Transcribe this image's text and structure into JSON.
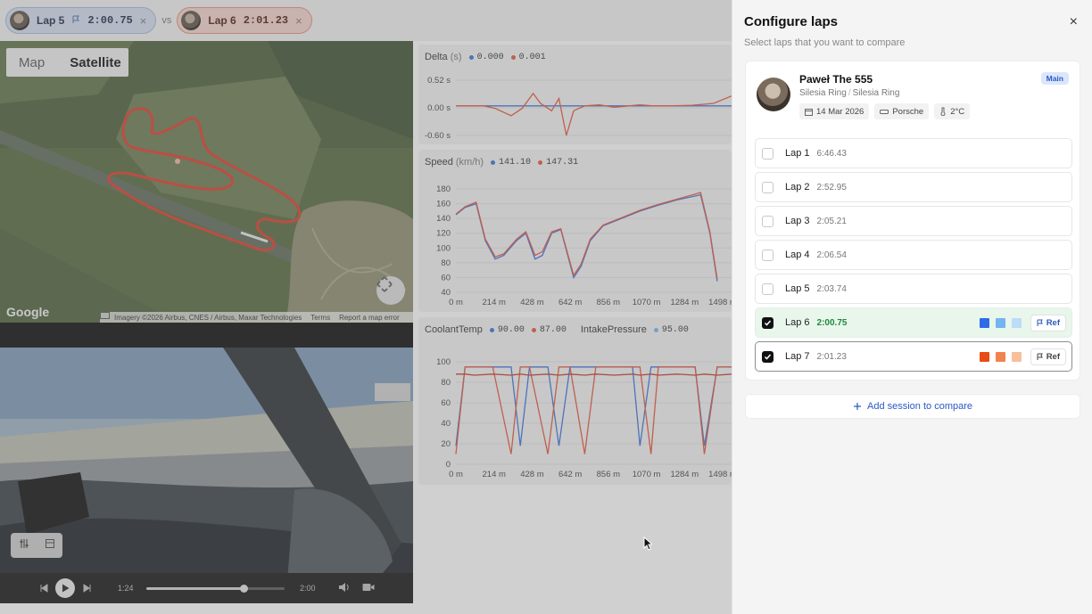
{
  "topbar": {
    "lap_a": {
      "label": "Lap 5",
      "time": "2:00.75",
      "close": "×"
    },
    "vs": "vs",
    "lap_b": {
      "label": "Lap 6",
      "time": "2:01.23",
      "close": "×"
    }
  },
  "map": {
    "toggle_map": "Map",
    "toggle_satellite": "Satellite",
    "logo": "Google",
    "attribution": "Imagery ©2026 Airbus, CNES / Airbus, Maxar Technologies",
    "terms": "Terms",
    "report": "Report a map error"
  },
  "video": {
    "current_time": "1:24",
    "duration": "2:00",
    "progress": 0.7
  },
  "charts": {
    "delta": {
      "title": "Delta",
      "unit": "(s)",
      "val_a": "0.000",
      "val_b": "0.001"
    },
    "speed": {
      "title": "Speed",
      "unit": "(km/h)",
      "val_a": "141.10",
      "val_b": "147.31"
    },
    "coolant": {
      "title": "CoolantTemp",
      "val_a": "90.00",
      "val_b": "87.00",
      "title2": "IntakePressure",
      "val_c": "95.00"
    }
  },
  "chart_data": [
    {
      "type": "line",
      "title": "Delta",
      "ylabel": "(s)",
      "yticks": [
        "0.52 s",
        "0.00 s",
        "-0.60 s"
      ],
      "ylim": [
        -0.6,
        0.52
      ],
      "x": [
        0,
        150,
        214,
        300,
        360,
        420,
        460,
        520,
        560,
        600,
        640,
        700,
        780,
        860,
        940,
        1000,
        1070,
        1150,
        1284,
        1400,
        1498
      ],
      "series": [
        {
          "color": "#3b6fd8",
          "values": [
            0,
            0,
            0,
            0,
            0,
            0,
            0,
            0,
            0,
            0,
            0,
            0,
            0,
            0,
            0,
            0,
            0,
            0,
            0,
            0,
            0
          ]
        },
        {
          "color": "#e0553b",
          "values": [
            0,
            0,
            -0.05,
            -0.2,
            -0.05,
            0.25,
            0.05,
            -0.1,
            0.15,
            -0.6,
            -0.1,
            0,
            0.02,
            -0.03,
            0,
            0.02,
            0,
            0,
            0.01,
            0.05,
            0.2
          ]
        }
      ]
    },
    {
      "type": "line",
      "title": "Speed",
      "ylabel": "(km/h)",
      "ylim": [
        40,
        180
      ],
      "yticks": [
        "180",
        "160",
        "140",
        "120",
        "100",
        "80",
        "60",
        "40"
      ],
      "xticks": [
        "0 m",
        "214 m",
        "428 m",
        "642 m",
        "856 m",
        "1070 m",
        "1284 m",
        "1498 m"
      ],
      "x": [
        0,
        50,
        110,
        160,
        214,
        260,
        330,
        380,
        430,
        470,
        520,
        570,
        640,
        680,
        730,
        800,
        900,
        1000,
        1100,
        1200,
        1330,
        1380,
        1420
      ],
      "series": [
        {
          "color": "#3b6fd8",
          "values": [
            145,
            155,
            160,
            110,
            85,
            90,
            110,
            120,
            85,
            90,
            120,
            125,
            60,
            75,
            110,
            130,
            140,
            150,
            158,
            165,
            172,
            120,
            55
          ]
        },
        {
          "color": "#e0553b",
          "values": [
            146,
            156,
            162,
            112,
            88,
            92,
            112,
            122,
            90,
            95,
            122,
            126,
            63,
            78,
            112,
            131,
            141,
            151,
            159,
            166,
            175,
            122,
            58
          ]
        }
      ]
    },
    {
      "type": "line",
      "title": "CoolantTemp",
      "ylim": [
        0,
        100
      ],
      "yticks": [
        "100",
        "80",
        "60",
        "40",
        "20",
        "0"
      ],
      "xticks": [
        "0 m",
        "214 m",
        "428 m",
        "642 m",
        "856 m",
        "1070 m",
        "1284 m",
        "1498 m"
      ],
      "x": [
        0,
        50,
        100,
        200,
        300,
        350,
        400,
        500,
        560,
        620,
        700,
        760,
        860,
        960,
        1000,
        1060,
        1100,
        1200,
        1300,
        1350,
        1420,
        1498
      ],
      "series": [
        {
          "color": "#3b6fd8",
          "values": [
            18,
            95,
            95,
            95,
            95,
            18,
            95,
            95,
            18,
            95,
            95,
            95,
            95,
            95,
            18,
            95,
            95,
            95,
            95,
            18,
            95,
            95
          ]
        },
        {
          "color": "#e0553b",
          "values": [
            10,
            95,
            95,
            95,
            10,
            95,
            95,
            10,
            95,
            95,
            10,
            95,
            95,
            95,
            95,
            10,
            95,
            95,
            95,
            10,
            95,
            95
          ]
        },
        {
          "color": "#c0392b",
          "values": [
            88,
            88,
            87,
            88,
            87,
            88,
            87,
            88,
            87,
            88,
            87,
            88,
            87,
            88,
            87,
            88,
            87,
            88,
            87,
            88,
            87,
            88
          ]
        }
      ]
    }
  ],
  "drawer": {
    "title": "Configure laps",
    "subtitle": "Select laps that you want to compare",
    "close": "×",
    "session": {
      "driver": "Paweł The 555",
      "track_a": "Silesia Ring",
      "sep": "/",
      "track_b": "Silesia Ring",
      "date": "14 Mar 2026",
      "car": "Porsche",
      "temp": "2°C",
      "badge": "Main"
    },
    "laps": [
      {
        "label": "Lap 1",
        "time": "6:46.43",
        "checked": false
      },
      {
        "label": "Lap 2",
        "time": "2:52.95",
        "checked": false
      },
      {
        "label": "Lap 3",
        "time": "2:05.21",
        "checked": false
      },
      {
        "label": "Lap 4",
        "time": "2:06.54",
        "checked": false
      },
      {
        "label": "Lap 5",
        "time": "2:03.74",
        "checked": false
      },
      {
        "label": "Lap 6",
        "time": "2:00.75",
        "checked": true,
        "ref": "Ref",
        "colors": [
          "#2f6be6",
          "#73b4f2",
          "#bcdcf8"
        ]
      },
      {
        "label": "Lap 7",
        "time": "2:01.23",
        "checked": true,
        "ref": "Ref",
        "colors": [
          "#ea4a14",
          "#f2834e",
          "#f7bf9c"
        ]
      }
    ],
    "add_session": "Add session to compare"
  }
}
